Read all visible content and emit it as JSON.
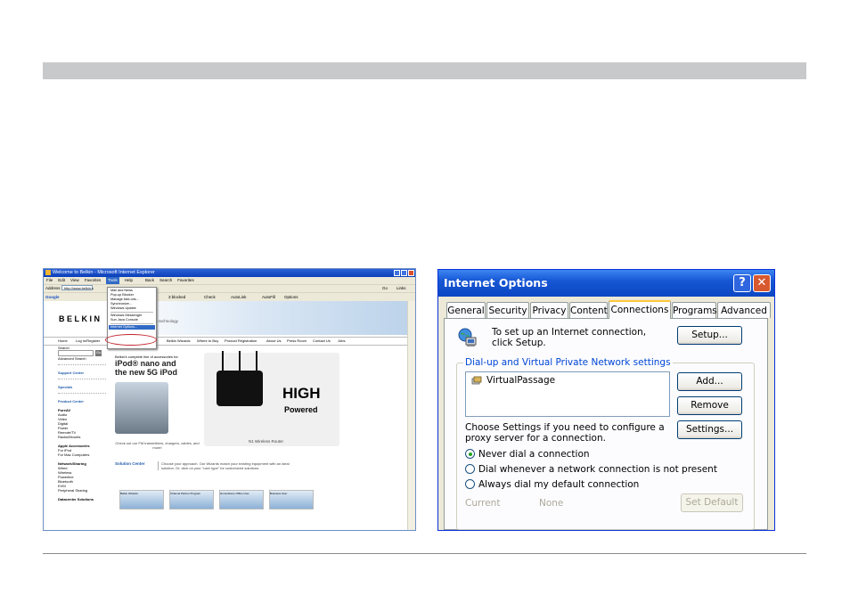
{
  "ie": {
    "title": "Welcome to Belkin - Microsoft Internet Explorer",
    "menu": [
      "File",
      "Edit",
      "View",
      "Favorites",
      "Tools",
      "Help"
    ],
    "address_label": "Address",
    "address_value": "http://www.belkin.c",
    "go_label": "Go",
    "links_label": "Links",
    "google_label": "Google",
    "toolbar_items": [
      "Back",
      "Search",
      "Favorites",
      "3 blocked",
      "Check",
      "AutoLink",
      "AutoFill",
      "Options"
    ],
    "tools_menu": {
      "items": [
        "Mail and News",
        "Pop-up Blocker",
        "Manage Add-ons...",
        "Synchronize...",
        "Windows Update",
        "Windows Messenger",
        "Sun Java Console",
        "Internet Options..."
      ],
      "selected": "Internet Options..."
    },
    "logo": "BELKIN",
    "tagline": "with technology",
    "nav_links": [
      "Home",
      "Log In/Register",
      "Belkin Wizards",
      "Where to Buy",
      "Product Registration",
      "About Us",
      "Press Room",
      "Contact Us",
      "Jobs"
    ],
    "search_label": "Search",
    "go_small": "Go",
    "advanced_search": "Advanced Search",
    "sidebar": {
      "support": "Support Center",
      "specials": "Specials",
      "product_center": "Product Center",
      "groups": [
        {
          "title": "PureAV",
          "items": [
            "Audio",
            "Video",
            "Digital",
            "Power",
            "Remote/TV",
            "Racks/Mounts"
          ]
        },
        {
          "title": "Apple Accessories",
          "items": [
            "For iPod",
            "For Mac Computers"
          ]
        },
        {
          "title": "Network/Sharing",
          "items": [
            "Wired",
            "Wireless",
            "Powerline",
            "Bluetooth",
            "KVM",
            "Peripheral Sharing"
          ]
        },
        {
          "title": "Datacenter Solutions",
          "items": []
        }
      ]
    },
    "ipod_promo": {
      "small": "Belkin's complete line of accessories for",
      "headline1": "iPod® nano and",
      "headline2": "the new 5G iPod",
      "caption": "Check out our FM transmitters, chargers, cables, and more!"
    },
    "router_promo": {
      "high": "HIGH",
      "powered": "Powered",
      "caption": "N1 Wireless Router"
    },
    "solution_center": {
      "label": "Solution Center",
      "text": "Choose your approach. Our Wizards match your existing equipment with an ideal solution. Or, click on your \"user type\" for customized solutions."
    },
    "thumbs": [
      "Belkin Wizards",
      "Channel Partner Program",
      "Home/Home Office User",
      "Business User"
    ]
  },
  "dialog": {
    "title": "Internet Options",
    "help_glyph": "?",
    "close_glyph": "✕",
    "tabs": [
      "General",
      "Security",
      "Privacy",
      "Content",
      "Connections",
      "Programs",
      "Advanced"
    ],
    "active_tab": "Connections",
    "setup_text": "To set up an Internet connection, click Setup.",
    "setup_button": "Setup...",
    "group_label": "Dial-up and Virtual Private Network settings",
    "connections": [
      "VirtualPassage"
    ],
    "add_button": "Add...",
    "remove_button": "Remove",
    "proxy_text": "Choose Settings if you need to configure a proxy server for a connection.",
    "settings_button": "Settings...",
    "radios": [
      {
        "label": "Never dial a connection",
        "checked": true
      },
      {
        "label": "Dial whenever a network connection is not present",
        "checked": false
      },
      {
        "label": "Always dial my default connection",
        "checked": false
      }
    ],
    "current_label": "Current",
    "current_value": "None",
    "set_default_button": "Set Default"
  }
}
